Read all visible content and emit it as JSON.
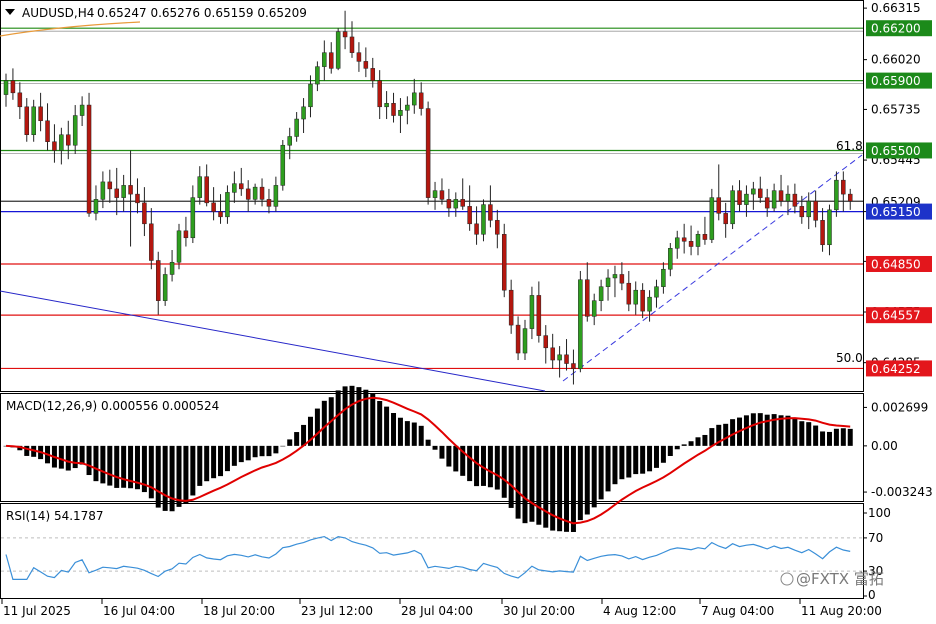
{
  "header": {
    "symbol": "AUDUSD,H4",
    "ohlc": "0.65247 0.65276 0.65159 0.65209"
  },
  "colors": {
    "bull": "#2e9e1f",
    "bear": "#b4170f",
    "green_line": "#1f8a12",
    "red_line": "#e01010",
    "blue_line": "#1515d6",
    "macd_signal": "#e00000",
    "rsi": "#3a8fd8",
    "tag_green": "#1c8a1a",
    "tag_red": "#e3161c",
    "tag_blue": "#1d33c9"
  },
  "price_axis": {
    "ticks": [
      "0.66315",
      "0.66020",
      "0.65735",
      "0.65445",
      "0.65150",
      "0.64865",
      "0.64575",
      "0.64285"
    ],
    "tick_values": [
      0.66315,
      0.6602,
      0.65735,
      0.65445,
      0.6515,
      0.64865,
      0.64575,
      0.64285
    ]
  },
  "levels": [
    {
      "value": 0.662,
      "label": "0.66200",
      "kind": "green"
    },
    {
      "value": 0.659,
      "label": "0.65900",
      "kind": "green"
    },
    {
      "value": 0.655,
      "label": "0.65500",
      "kind": "green"
    },
    {
      "value": 0.65209,
      "label": "0.65209",
      "kind": "current"
    },
    {
      "value": 0.6515,
      "label": "0.65150",
      "kind": "blue"
    },
    {
      "value": 0.6485,
      "label": "0.64850",
      "kind": "red"
    },
    {
      "value": 0.64557,
      "label": "0.64557",
      "kind": "red"
    },
    {
      "value": 0.64252,
      "label": "0.64252",
      "kind": "red"
    }
  ],
  "fib_labels": {
    "top": "61.8",
    "bottom": "50.0"
  },
  "time_axis": [
    "11 Jul 2025",
    "16 Jul 04:00",
    "18 Jul 20:00",
    "23 Jul 12:00",
    "28 Jul 04:00",
    "30 Jul 20:00",
    "4 Aug 12:00",
    "7 Aug 04:00",
    "11 Aug 20:00"
  ],
  "macd": {
    "label": "MACD(12,26,9) 0.000556 0.000524",
    "axis": [
      "0.002699",
      "0.00",
      "-0.003243"
    ],
    "axis_values": [
      0.002699,
      0.0,
      -0.003243
    ]
  },
  "rsi": {
    "label": "RSI(14) 54.1787",
    "axis": [
      "100",
      "70",
      "30",
      "0"
    ],
    "axis_values": [
      100,
      70,
      30,
      0
    ]
  },
  "watermark": "@FXTX 富拓",
  "chart_data": {
    "type": "candlestick",
    "candles": [
      [
        0.6582,
        0.6594,
        0.6575,
        0.659
      ],
      [
        0.659,
        0.6597,
        0.6579,
        0.6583
      ],
      [
        0.6583,
        0.6589,
        0.6568,
        0.6575
      ],
      [
        0.6575,
        0.658,
        0.6555,
        0.6559
      ],
      [
        0.6559,
        0.6579,
        0.6555,
        0.6575
      ],
      [
        0.6575,
        0.6583,
        0.6561,
        0.6567
      ],
      [
        0.6567,
        0.6577,
        0.655,
        0.6555
      ],
      [
        0.6555,
        0.6565,
        0.6543,
        0.655
      ],
      [
        0.655,
        0.6563,
        0.6542,
        0.6559
      ],
      [
        0.6559,
        0.6567,
        0.6545,
        0.6553
      ],
      [
        0.6553,
        0.6576,
        0.6548,
        0.657
      ],
      [
        0.657,
        0.6581,
        0.6564,
        0.6576
      ],
      [
        0.6576,
        0.6583,
        0.6512,
        0.6514
      ],
      [
        0.6514,
        0.653,
        0.651,
        0.6522
      ],
      [
        0.6522,
        0.6538,
        0.6517,
        0.6532
      ],
      [
        0.6532,
        0.6539,
        0.652,
        0.6528
      ],
      [
        0.6528,
        0.654,
        0.6513,
        0.6523
      ],
      [
        0.6523,
        0.6536,
        0.6515,
        0.653
      ],
      [
        0.653,
        0.655,
        0.6495,
        0.6525
      ],
      [
        0.6525,
        0.6534,
        0.6514,
        0.652
      ],
      [
        0.652,
        0.6529,
        0.6501,
        0.6508
      ],
      [
        0.6508,
        0.6517,
        0.6482,
        0.6487
      ],
      [
        0.6487,
        0.6492,
        0.6456,
        0.6464
      ],
      [
        0.6464,
        0.6483,
        0.6461,
        0.6479
      ],
      [
        0.6479,
        0.6493,
        0.6475,
        0.6486
      ],
      [
        0.6486,
        0.6508,
        0.6482,
        0.6504
      ],
      [
        0.6504,
        0.6512,
        0.6495,
        0.65
      ],
      [
        0.65,
        0.653,
        0.6497,
        0.6523
      ],
      [
        0.6523,
        0.6541,
        0.6519,
        0.6535
      ],
      [
        0.6535,
        0.6542,
        0.6518,
        0.652
      ],
      [
        0.652,
        0.6529,
        0.651,
        0.6515
      ],
      [
        0.6515,
        0.6525,
        0.6508,
        0.6512
      ],
      [
        0.6512,
        0.653,
        0.6508,
        0.6526
      ],
      [
        0.6526,
        0.6538,
        0.652,
        0.6531
      ],
      [
        0.6531,
        0.654,
        0.6524,
        0.6528
      ],
      [
        0.6528,
        0.6533,
        0.6515,
        0.6522
      ],
      [
        0.6522,
        0.6531,
        0.6519,
        0.6529
      ],
      [
        0.6529,
        0.6534,
        0.6518,
        0.6522
      ],
      [
        0.6522,
        0.6528,
        0.6514,
        0.6518
      ],
      [
        0.6518,
        0.6535,
        0.6515,
        0.653
      ],
      [
        0.653,
        0.6556,
        0.6527,
        0.6553
      ],
      [
        0.6553,
        0.6563,
        0.6545,
        0.6558
      ],
      [
        0.6558,
        0.6572,
        0.6555,
        0.6568
      ],
      [
        0.6568,
        0.658,
        0.656,
        0.6575
      ],
      [
        0.6575,
        0.6593,
        0.6569,
        0.6588
      ],
      [
        0.6588,
        0.6601,
        0.6584,
        0.6598
      ],
      [
        0.6598,
        0.6613,
        0.659,
        0.6606
      ],
      [
        0.6606,
        0.6612,
        0.6594,
        0.6597
      ],
      [
        0.6597,
        0.662,
        0.6596,
        0.6618
      ],
      [
        0.6618,
        0.663,
        0.6608,
        0.6615
      ],
      [
        0.6615,
        0.6624,
        0.6603,
        0.6606
      ],
      [
        0.6606,
        0.6612,
        0.6595,
        0.6601
      ],
      [
        0.6601,
        0.6609,
        0.6592,
        0.6597
      ],
      [
        0.6597,
        0.6603,
        0.6586,
        0.659
      ],
      [
        0.659,
        0.6596,
        0.6568,
        0.6575
      ],
      [
        0.6575,
        0.6584,
        0.6568,
        0.6577
      ],
      [
        0.6577,
        0.6583,
        0.6566,
        0.657
      ],
      [
        0.657,
        0.658,
        0.656,
        0.6573
      ],
      [
        0.6573,
        0.6581,
        0.6565,
        0.6576
      ],
      [
        0.6576,
        0.6591,
        0.6571,
        0.6583
      ],
      [
        0.6583,
        0.6589,
        0.657,
        0.6574
      ],
      [
        0.6574,
        0.6578,
        0.6519,
        0.6523
      ],
      [
        0.6523,
        0.6532,
        0.6516,
        0.6527
      ],
      [
        0.6527,
        0.6534,
        0.6519,
        0.6522
      ],
      [
        0.6522,
        0.6528,
        0.6512,
        0.6517
      ],
      [
        0.6517,
        0.6526,
        0.6512,
        0.6522
      ],
      [
        0.6522,
        0.6534,
        0.6516,
        0.6518
      ],
      [
        0.6518,
        0.653,
        0.6504,
        0.6508
      ],
      [
        0.6508,
        0.6518,
        0.6496,
        0.6502
      ],
      [
        0.6502,
        0.6522,
        0.6498,
        0.6519
      ],
      [
        0.6519,
        0.653,
        0.6506,
        0.651
      ],
      [
        0.651,
        0.6516,
        0.6494,
        0.6502
      ],
      [
        0.6502,
        0.6508,
        0.6466,
        0.647
      ],
      [
        0.647,
        0.6476,
        0.6445,
        0.645
      ],
      [
        0.645,
        0.6455,
        0.643,
        0.6434
      ],
      [
        0.6434,
        0.6453,
        0.643,
        0.6448
      ],
      [
        0.6448,
        0.6472,
        0.6442,
        0.6467
      ],
      [
        0.6467,
        0.6475,
        0.644,
        0.6444
      ],
      [
        0.6444,
        0.645,
        0.6428,
        0.6437
      ],
      [
        0.6437,
        0.6445,
        0.6425,
        0.643
      ],
      [
        0.643,
        0.6438,
        0.642,
        0.6433
      ],
      [
        0.6433,
        0.6442,
        0.6424,
        0.6428
      ],
      [
        0.6428,
        0.6436,
        0.6416,
        0.6425
      ],
      [
        0.6425,
        0.6481,
        0.6423,
        0.6476
      ],
      [
        0.6476,
        0.6486,
        0.6452,
        0.6455
      ],
      [
        0.6455,
        0.6468,
        0.645,
        0.6464
      ],
      [
        0.6464,
        0.6476,
        0.6458,
        0.6472
      ],
      [
        0.6472,
        0.6482,
        0.6464,
        0.6477
      ],
      [
        0.6477,
        0.6484,
        0.6466,
        0.6479
      ],
      [
        0.6479,
        0.6486,
        0.647,
        0.6474
      ],
      [
        0.6474,
        0.6481,
        0.6458,
        0.6462
      ],
      [
        0.6462,
        0.6475,
        0.6456,
        0.647
      ],
      [
        0.647,
        0.6474,
        0.6454,
        0.6458
      ],
      [
        0.6458,
        0.647,
        0.6452,
        0.6466
      ],
      [
        0.6466,
        0.6476,
        0.646,
        0.6472
      ],
      [
        0.6472,
        0.6486,
        0.6468,
        0.6482
      ],
      [
        0.6482,
        0.6497,
        0.6478,
        0.6494
      ],
      [
        0.6494,
        0.6504,
        0.6488,
        0.65
      ],
      [
        0.65,
        0.6508,
        0.6491,
        0.6498
      ],
      [
        0.6498,
        0.6507,
        0.649,
        0.6495
      ],
      [
        0.6495,
        0.6504,
        0.649,
        0.6502
      ],
      [
        0.6502,
        0.6512,
        0.6496,
        0.6499
      ],
      [
        0.6499,
        0.6528,
        0.6497,
        0.6523
      ],
      [
        0.6523,
        0.6542,
        0.651,
        0.6514
      ],
      [
        0.6514,
        0.652,
        0.65,
        0.6508
      ],
      [
        0.6508,
        0.653,
        0.6505,
        0.6527
      ],
      [
        0.6527,
        0.6533,
        0.6515,
        0.6519
      ],
      [
        0.6519,
        0.653,
        0.6512,
        0.6525
      ],
      [
        0.6525,
        0.6532,
        0.6516,
        0.6528
      ],
      [
        0.6528,
        0.6535,
        0.652,
        0.6523
      ],
      [
        0.6523,
        0.6528,
        0.6512,
        0.6517
      ],
      [
        0.6517,
        0.6531,
        0.6515,
        0.6527
      ],
      [
        0.6527,
        0.6536,
        0.6518,
        0.6521
      ],
      [
        0.6521,
        0.653,
        0.6513,
        0.6525
      ],
      [
        0.6525,
        0.6531,
        0.6514,
        0.6518
      ],
      [
        0.6518,
        0.6524,
        0.6508,
        0.6512
      ],
      [
        0.6512,
        0.6526,
        0.6505,
        0.6521
      ],
      [
        0.6521,
        0.6527,
        0.6506,
        0.651
      ],
      [
        0.651,
        0.6517,
        0.6492,
        0.6496
      ],
      [
        0.6496,
        0.6519,
        0.649,
        0.6516
      ],
      [
        0.6516,
        0.6538,
        0.6512,
        0.6533
      ],
      [
        0.6533,
        0.6538,
        0.6515,
        0.6525
      ],
      [
        0.6525,
        0.6528,
        0.6516,
        0.6521
      ]
    ]
  }
}
